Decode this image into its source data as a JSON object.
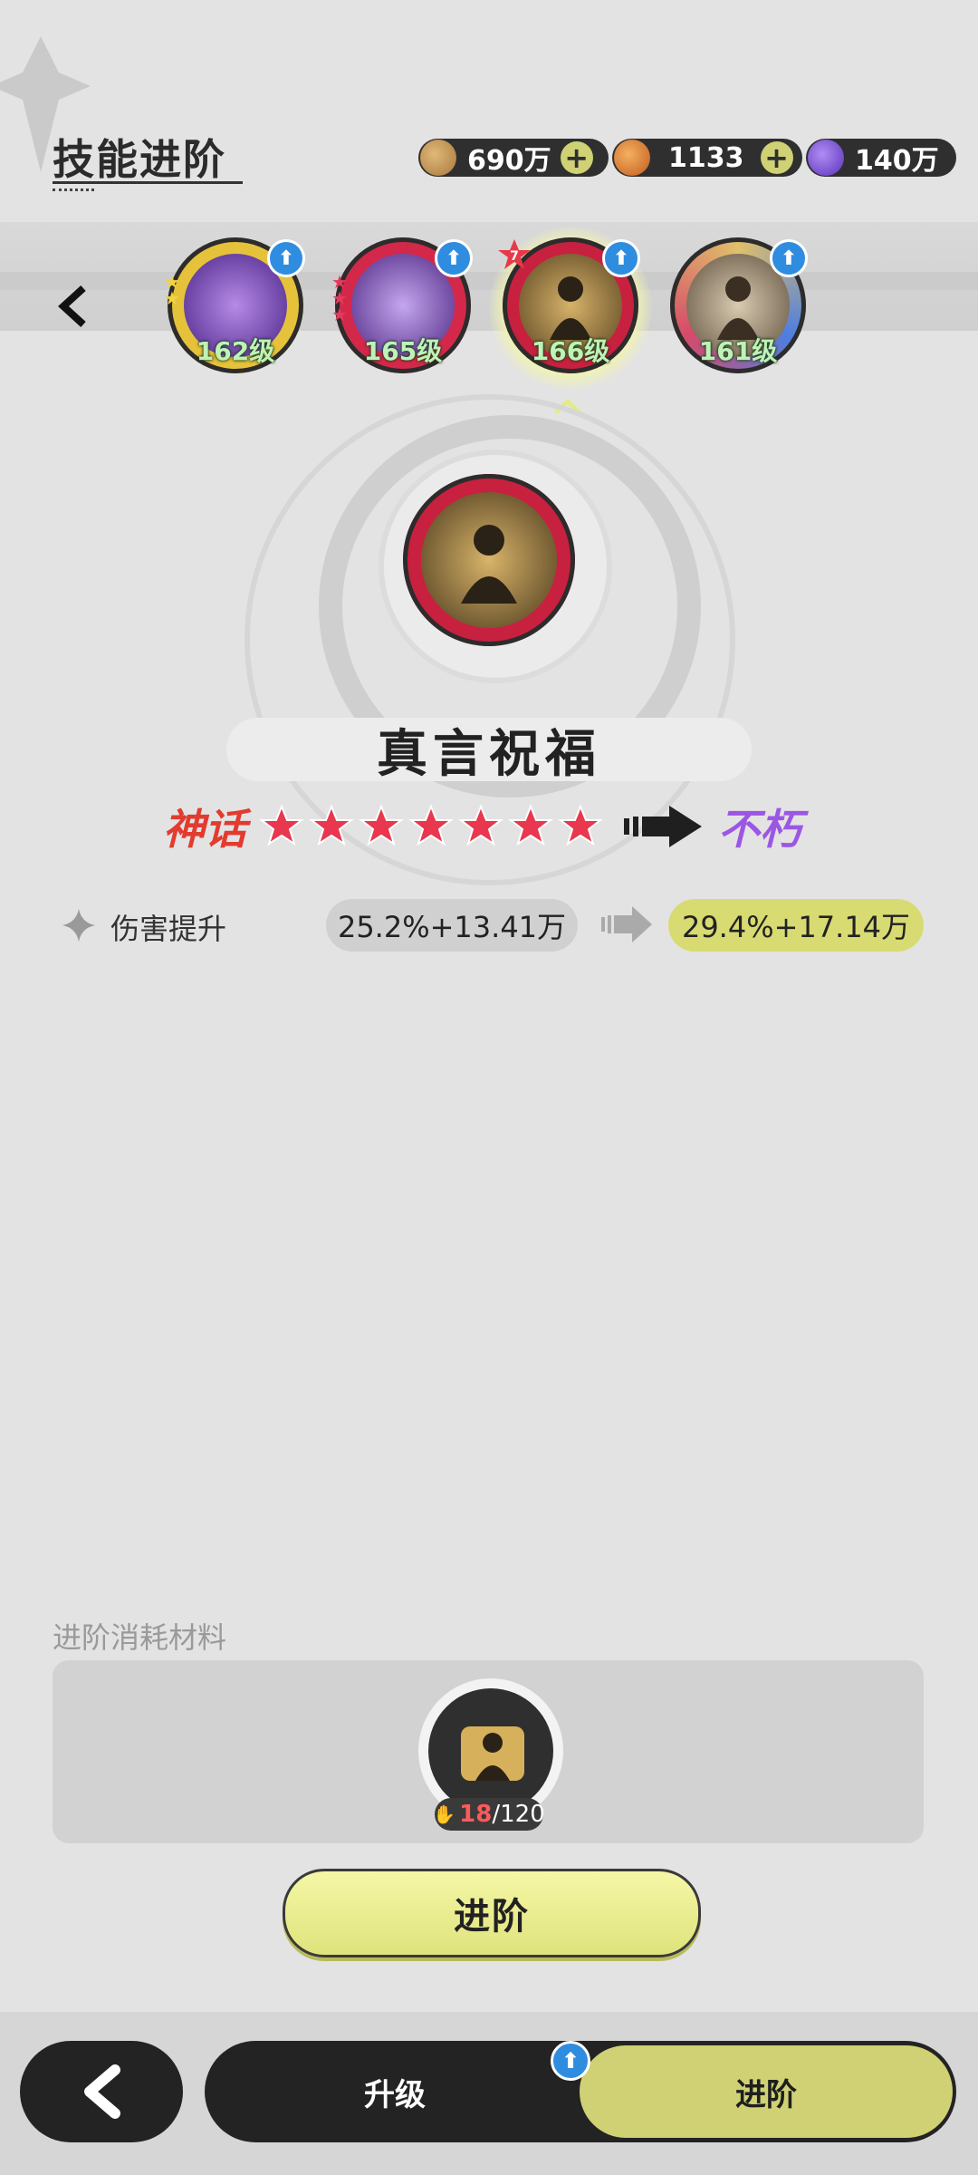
{
  "header": {
    "title": "技能进阶",
    "currencies": [
      {
        "name": "coin",
        "value": "690万",
        "color": "#b88a4a"
      },
      {
        "name": "crystal",
        "value": "1133",
        "color": "#d67a2a"
      },
      {
        "name": "gem",
        "value": "140万",
        "color": "#7a4fd6"
      }
    ],
    "plus_label": "+"
  },
  "skill_list": {
    "back_icon": "chevron-left-icon",
    "items": [
      {
        "level": "162级",
        "ring": "#e6c23a",
        "core": "#6b3fb8",
        "stars": 2,
        "star_color": "gold",
        "upgradable": true
      },
      {
        "level": "165级",
        "ring": "#d4284a",
        "core": "#5b2e8f",
        "stars": 3,
        "star_color": "red",
        "upgradable": true
      },
      {
        "level": "166级",
        "ring": "#c8203f",
        "core": "#a07a2a",
        "stars": 7,
        "star_badge": "7",
        "selected": true,
        "upgradable": true
      },
      {
        "level": "161级",
        "ring": "#3c6fd0",
        "core": "#6a5a45",
        "stars": 0,
        "upgradable": true
      }
    ]
  },
  "skill": {
    "name": "真言祝福",
    "rank_from": "神话",
    "rank_stars": 7,
    "rank_to": "不朽",
    "stat": {
      "label": "伤害提升",
      "current": "25.2%+13.41万",
      "next": "29.4%+17.14万"
    }
  },
  "materials": {
    "label": "进阶消耗材料",
    "have": "18",
    "need": "/120"
  },
  "advance_button": "进阶",
  "tabs": {
    "upgrade": "升级",
    "advance": "进阶",
    "active": "advance"
  },
  "colors": {
    "accent": "#cfd174",
    "dark": "#232323"
  }
}
